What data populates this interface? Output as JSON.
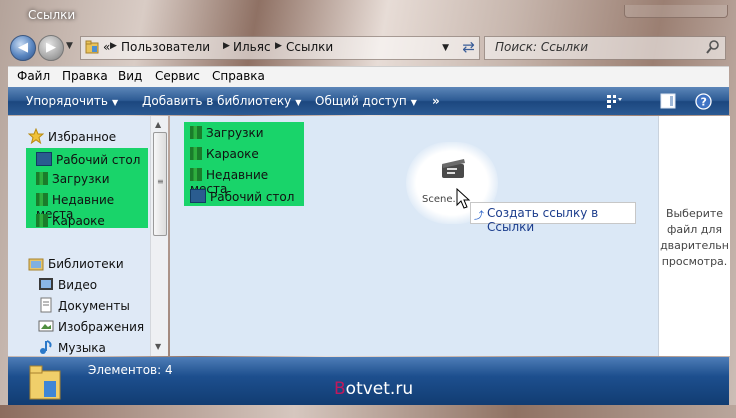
{
  "window": {
    "title": "Ссылки"
  },
  "address": {
    "breadcrumbs": [
      "Пользователи",
      "Ильяс",
      "Ссылки"
    ],
    "overflow": "«",
    "back_icon": "back-arrow-icon",
    "forward_icon": "forward-arrow-icon"
  },
  "search": {
    "placeholder": "Поиск: Ссылки"
  },
  "menu": {
    "items": [
      "Файл",
      "Правка",
      "Вид",
      "Сервис",
      "Справка"
    ]
  },
  "toolbar": {
    "organize": "Упорядочить",
    "add_to_library": "Добавить в библиотеку",
    "share": "Общий доступ",
    "more": "»"
  },
  "sidebar": {
    "favorites": {
      "label": "Избранное",
      "items": [
        "Рабочий стол",
        "Загрузки",
        "Недавние места",
        "Караоке"
      ]
    },
    "libraries": {
      "label": "Библиотеки",
      "items": [
        "Видео",
        "Документы",
        "Изображения",
        "Музыка"
      ]
    }
  },
  "content": {
    "items": [
      "Загрузки",
      "Караоке",
      "Недавние места",
      "Рабочий стол"
    ],
    "drag_item_name": "Scene...",
    "tooltip": "Создать ссылку в Ссылки"
  },
  "preview": {
    "text_lines": [
      "Выберите",
      "файл для",
      "дварительн",
      "просмотра."
    ]
  },
  "status": {
    "items_count": "Элементов: 4"
  },
  "watermark": {
    "b": "B",
    "rest": "otvet.ru"
  },
  "colors": {
    "highlight": "#19d46a",
    "toolbar": "#2d5b94"
  }
}
